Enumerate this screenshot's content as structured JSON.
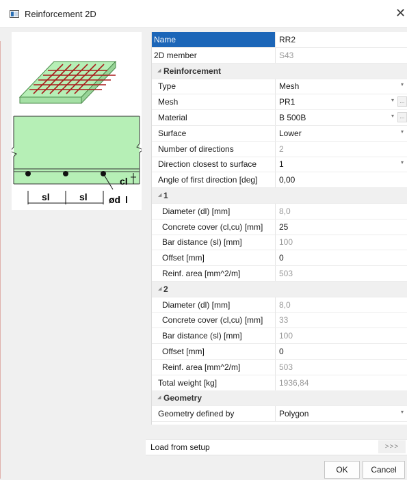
{
  "window": {
    "title": "Reinforcement 2D",
    "close_glyph": "✕"
  },
  "illustration": {
    "spacing_label_1": "sl",
    "spacing_label_2": "sl",
    "diameter_label": "ød",
    "diameter_sub": "l",
    "cover_label": "cl"
  },
  "properties": [
    {
      "label": "Name",
      "value": "RR2",
      "kind": "selected"
    },
    {
      "label": "2D member",
      "value": "S43",
      "kind": "ro",
      "indent": 0
    },
    {
      "label": "Reinforcement",
      "kind": "group",
      "indent": 0
    },
    {
      "label": "Type",
      "value": "Mesh",
      "kind": "dropdown",
      "indent": 1
    },
    {
      "label": "Mesh",
      "value": "PR1",
      "kind": "dropdown-more",
      "indent": 1
    },
    {
      "label": "Material",
      "value": "B 500B",
      "kind": "dropdown-more",
      "indent": 1
    },
    {
      "label": "Surface",
      "value": "Lower",
      "kind": "dropdown",
      "indent": 1
    },
    {
      "label": "Number of directions",
      "value": "2",
      "kind": "ro",
      "indent": 1
    },
    {
      "label": "Direction closest to surface",
      "value": "1",
      "kind": "dropdown",
      "indent": 1
    },
    {
      "label": "Angle of first direction [deg]",
      "value": "0,00",
      "kind": "edit",
      "indent": 1
    },
    {
      "label": "1",
      "kind": "group",
      "indent": 1
    },
    {
      "label": "Diameter (dl) [mm]",
      "value": "8,0",
      "kind": "ro",
      "indent": 2
    },
    {
      "label": "Concrete cover (cl,cu) [mm]",
      "value": "25",
      "kind": "edit",
      "indent": 2
    },
    {
      "label": "Bar distance (sl) [mm]",
      "value": "100",
      "kind": "ro",
      "indent": 2
    },
    {
      "label": "Offset [mm]",
      "value": "0",
      "kind": "edit",
      "indent": 2
    },
    {
      "label": "Reinf. area [mm^2/m]",
      "value": "503",
      "kind": "ro",
      "indent": 2
    },
    {
      "label": "2",
      "kind": "group",
      "indent": 1
    },
    {
      "label": "Diameter (dl) [mm]",
      "value": "8,0",
      "kind": "ro",
      "indent": 2
    },
    {
      "label": "Concrete cover (cl,cu) [mm]",
      "value": "33",
      "kind": "ro",
      "indent": 2
    },
    {
      "label": "Bar distance (sl) [mm]",
      "value": "100",
      "kind": "ro",
      "indent": 2
    },
    {
      "label": "Offset [mm]",
      "value": "0",
      "kind": "edit",
      "indent": 2
    },
    {
      "label": "Reinf. area [mm^2/m]",
      "value": "503",
      "kind": "ro",
      "indent": 2
    },
    {
      "label": "Total weight [kg]",
      "value": "1936,84",
      "kind": "ro",
      "indent": 1
    },
    {
      "label": "Geometry",
      "kind": "group",
      "indent": 0
    },
    {
      "label": "Geometry defined by",
      "value": "Polygon",
      "kind": "dropdown",
      "indent": 1
    }
  ],
  "setup": {
    "label": "Load from setup",
    "button": ">>>"
  },
  "footer": {
    "ok": "OK",
    "cancel": "Cancel"
  },
  "glyphs": {
    "dropdown": "▾",
    "more": "...",
    "expand": "◢"
  }
}
